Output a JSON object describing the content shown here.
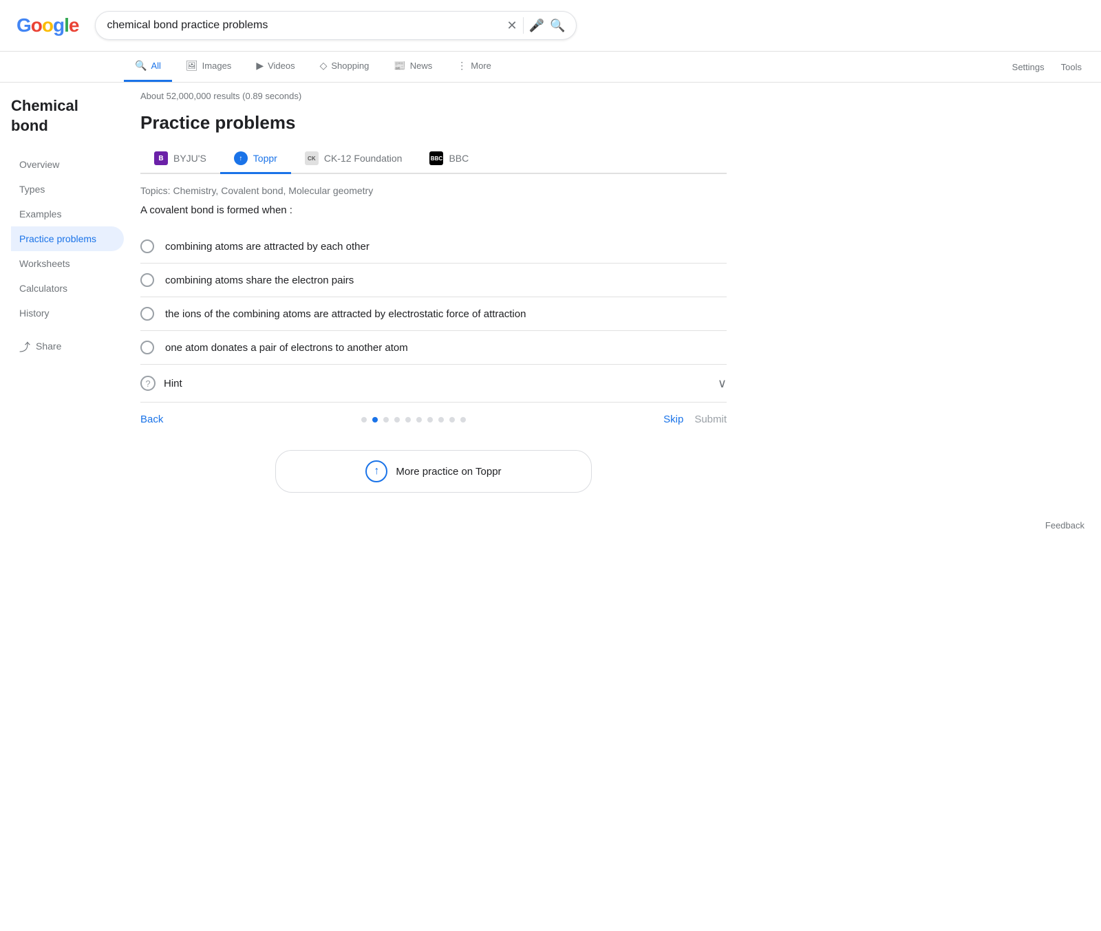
{
  "header": {
    "logo": {
      "G": "G",
      "o1": "o",
      "o2": "o",
      "g": "g",
      "l": "l",
      "e": "e"
    },
    "search_query": "chemical bond practice problems",
    "clear_title": "Clear search",
    "mic_title": "Search by voice",
    "search_title": "Google Search"
  },
  "nav_tabs": {
    "tabs": [
      {
        "id": "all",
        "label": "All",
        "icon": "🔍",
        "active": true
      },
      {
        "id": "images",
        "label": "Images",
        "icon": "🖼"
      },
      {
        "id": "videos",
        "label": "Videos",
        "icon": "▶"
      },
      {
        "id": "shopping",
        "label": "Shopping",
        "icon": "◇"
      },
      {
        "id": "news",
        "label": "News",
        "icon": "📰"
      },
      {
        "id": "more",
        "label": "More",
        "icon": "⋮"
      }
    ],
    "settings_label": "Settings",
    "tools_label": "Tools"
  },
  "sidebar": {
    "title": "Chemical bond",
    "items": [
      {
        "id": "overview",
        "label": "Overview",
        "active": false
      },
      {
        "id": "types",
        "label": "Types",
        "active": false
      },
      {
        "id": "examples",
        "label": "Examples",
        "active": false
      },
      {
        "id": "practice",
        "label": "Practice problems",
        "active": true
      },
      {
        "id": "worksheets",
        "label": "Worksheets",
        "active": false
      },
      {
        "id": "calculators",
        "label": "Calculators",
        "active": false
      },
      {
        "id": "history",
        "label": "History",
        "active": false
      }
    ],
    "share_label": "Share"
  },
  "content": {
    "results_count": "About 52,000,000 results (0.89 seconds)",
    "section_title": "Practice problems",
    "source_tabs": [
      {
        "id": "byjus",
        "label": "BYJU'S",
        "logo_type": "byju",
        "active": false
      },
      {
        "id": "toppr",
        "label": "Toppr",
        "logo_type": "toppr",
        "active": true
      },
      {
        "id": "ck12",
        "label": "CK-12 Foundation",
        "logo_type": "ck12",
        "active": false
      },
      {
        "id": "bbc",
        "label": "BBC",
        "logo_type": "bbc",
        "active": false
      }
    ],
    "topics": "Topics: Chemistry, Covalent bond, Molecular geometry",
    "question": "A covalent bond is formed when :",
    "options": [
      {
        "id": "opt1",
        "text": "combining atoms are attracted by each other"
      },
      {
        "id": "opt2",
        "text": "combining atoms share the electron pairs"
      },
      {
        "id": "opt3",
        "text": "the ions of the combining atoms are attracted by electrostatic force of attraction"
      },
      {
        "id": "opt4",
        "text": "one atom donates a pair of electrons to another atom"
      }
    ],
    "hint_label": "Hint",
    "nav": {
      "back_label": "Back",
      "skip_label": "Skip",
      "submit_label": "Submit",
      "dots_count": 10,
      "active_dot": 1
    },
    "more_practice_label": "More practice on Toppr"
  },
  "feedback": {
    "label": "Feedback"
  }
}
